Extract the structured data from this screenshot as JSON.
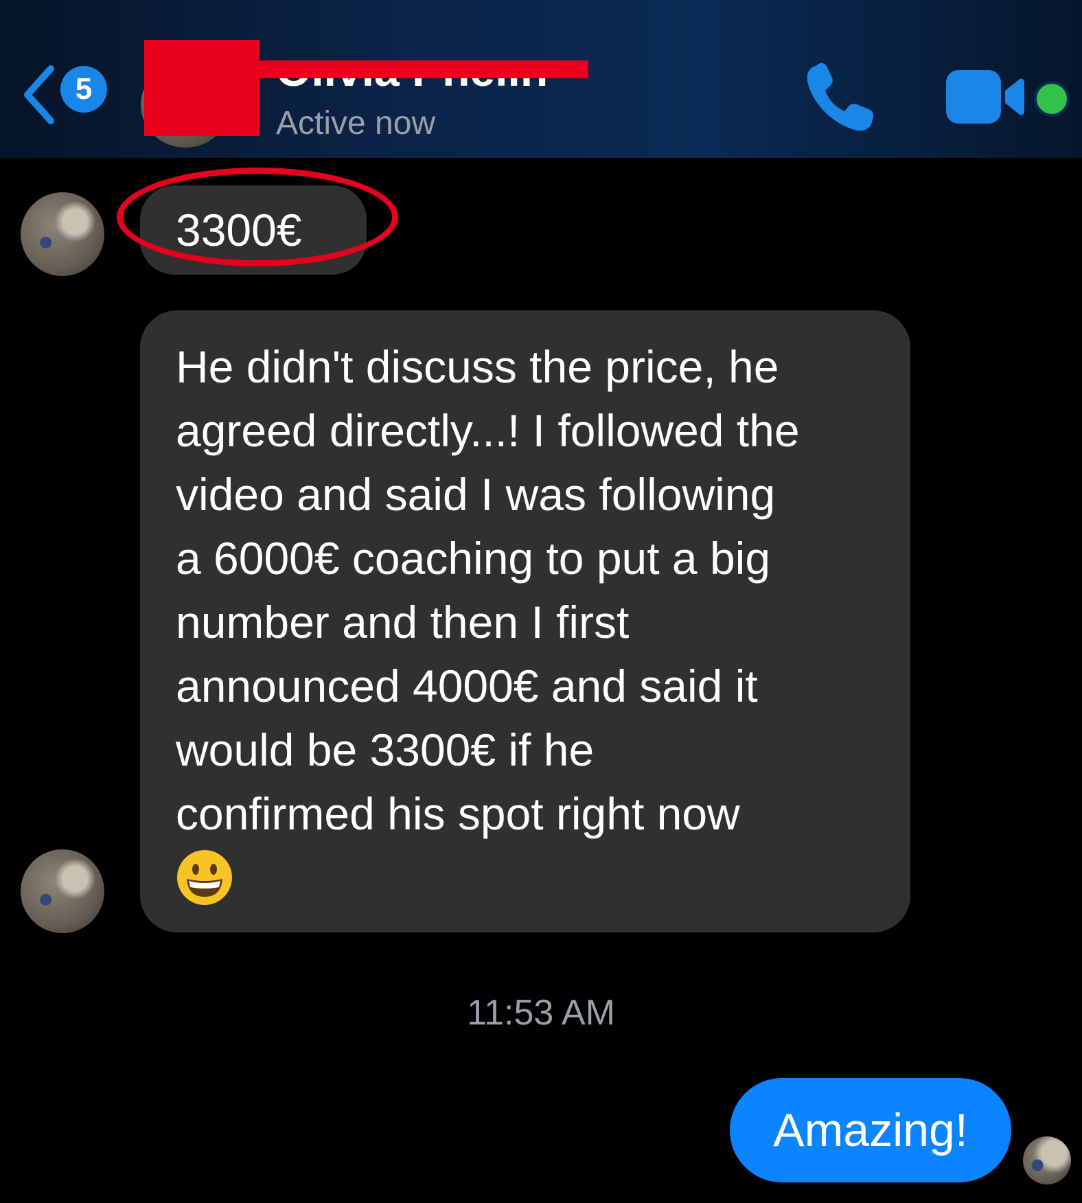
{
  "header": {
    "back_count": "5",
    "contact_name": "Olivia Phelin",
    "status": "Active now",
    "colors": {
      "accent": "#1a86e8",
      "online": "#31c24c",
      "redaction": "#e8001f"
    }
  },
  "icons": {
    "back": "chevron-left-icon",
    "call": "phone-icon",
    "video": "video-camera-icon"
  },
  "messages": {
    "incoming_price": "3300€",
    "incoming_long_lines": [
      "He didn't discuss the price, he",
      "agreed directly...! I followed the",
      "video and said I was following",
      "a 6000€ coaching to put a big",
      "number and then I first",
      "announced 4000€ and said it",
      "would be 3300€ if he",
      "confirmed his spot right now"
    ],
    "emoji": "grinning-face",
    "timestamp": "11:53 AM",
    "outgoing": "Amazing!"
  }
}
